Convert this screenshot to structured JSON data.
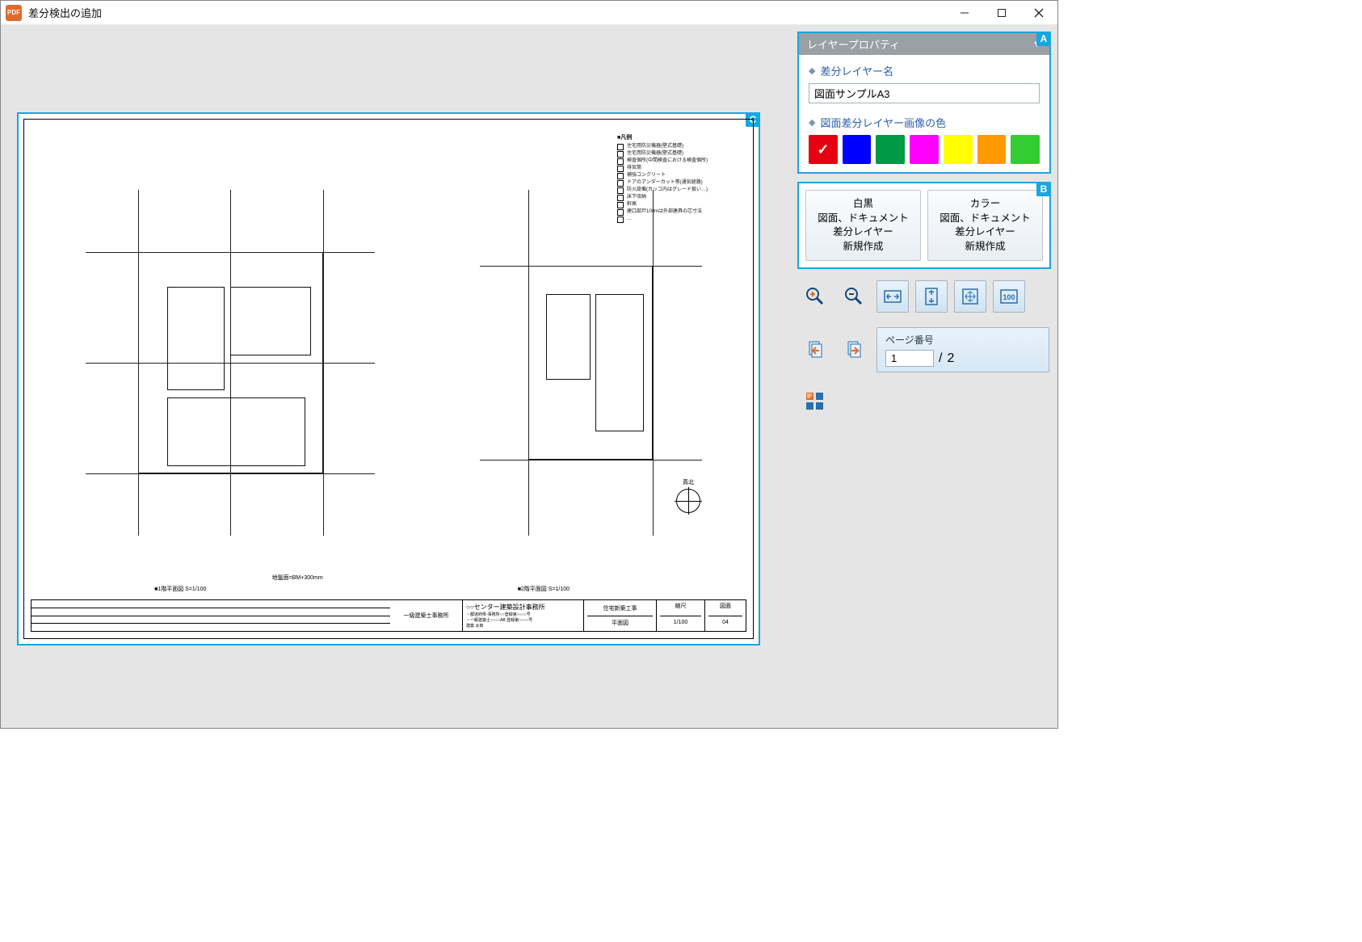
{
  "window": {
    "title": "差分検出の追加",
    "app_icon_text": "PDF"
  },
  "panel_a": {
    "header": "レイヤープロパティ",
    "layer_name_label": "差分レイヤー名",
    "layer_name_value": "図面サンプルA3",
    "color_label": "図面差分レイヤー画像の色",
    "colors": [
      "#e60012",
      "#0000ff",
      "#009944",
      "#ff00ff",
      "#ffff00",
      "#ff9900",
      "#33cc33"
    ],
    "selected_color_index": 0,
    "badge": "A"
  },
  "panel_b": {
    "btn_bw": "白黒\n図面、ドキュメント\n差分レイヤー\n新規作成",
    "btn_color": "カラー\n図面、ドキュメント\n差分レイヤー\n新規作成",
    "badge": "B"
  },
  "canvas": {
    "badge": "C",
    "legend_title": "■凡例",
    "legend_items": [
      "住宅用防災機器(壁式基礎)",
      "住宅用防災機器(壁式基礎)",
      "検査個所(中間検査における検査個所)",
      "排気筒",
      "補強コンクリート",
      "ドアのアンダーカット等(通気経路)",
      "防火設備(カッコ内はグレード扱い…)",
      "床下収納",
      "軒高",
      "建口部戸100mは外部建具の芯寸法",
      "…"
    ],
    "plan1_caption": "■1階平面図 S=1/100",
    "plan2_caption": "■2階平面図 S=1/100",
    "compass_label": "真北",
    "note_text": "地盤面=BM+300mm",
    "titleblock": {
      "office_label": "一級建築士事務所",
      "office_name": "○○センター建築設計事務所",
      "license_lines": "・都道府県-事務所○○登録第○○○○号\n・一級建築士○○○○AB 登録第○○○○号\n建築 太郎",
      "project_label": "住宅新築工事",
      "drawing_label": "平面図",
      "scale_label": "縮尺",
      "scale_value": "1/100",
      "sheet_label": "図面",
      "sheet_value": "04"
    }
  },
  "tools": {
    "zoom_in": "zoom-in",
    "zoom_out": "zoom-out",
    "fit_width": "fit-width",
    "fit_height": "fit-height",
    "fit_page": "fit-page",
    "zoom_100": "100"
  },
  "nav": {
    "page_label": "ページ番号",
    "current_page": "1",
    "total_pages": "2",
    "separator": "/"
  }
}
